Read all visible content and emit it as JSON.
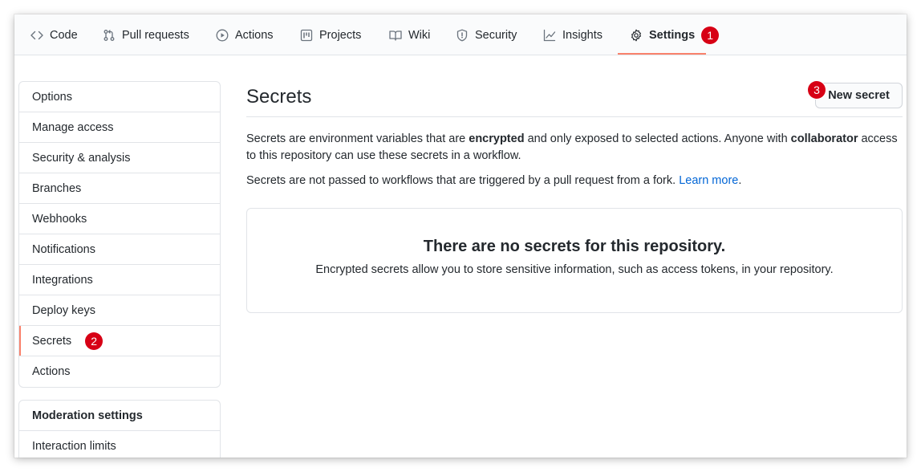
{
  "nav": {
    "tabs": [
      {
        "label": "Code",
        "icon": "code-icon"
      },
      {
        "label": "Pull requests",
        "icon": "pull-request-icon"
      },
      {
        "label": "Actions",
        "icon": "play-icon"
      },
      {
        "label": "Projects",
        "icon": "project-icon"
      },
      {
        "label": "Wiki",
        "icon": "book-icon"
      },
      {
        "label": "Security",
        "icon": "shield-icon"
      },
      {
        "label": "Insights",
        "icon": "graph-icon"
      },
      {
        "label": "Settings",
        "icon": "gear-icon",
        "active": true
      }
    ],
    "settings_badge": "1"
  },
  "sidebar": {
    "items": [
      {
        "label": "Options"
      },
      {
        "label": "Manage access"
      },
      {
        "label": "Security & analysis"
      },
      {
        "label": "Branches"
      },
      {
        "label": "Webhooks"
      },
      {
        "label": "Notifications"
      },
      {
        "label": "Integrations"
      },
      {
        "label": "Deploy keys"
      },
      {
        "label": "Secrets",
        "selected": true
      },
      {
        "label": "Actions"
      }
    ],
    "secrets_badge": "2",
    "moderation": {
      "heading": "Moderation settings",
      "items": [
        {
          "label": "Interaction limits"
        }
      ]
    }
  },
  "main": {
    "title": "Secrets",
    "new_secret_label": "New secret",
    "new_secret_badge": "3",
    "description": {
      "p1_part1": "Secrets are environment variables that are ",
      "p1_bold1": "encrypted",
      "p1_part2": " and only exposed to selected actions. Anyone with ",
      "p1_bold2": "collaborator",
      "p1_part3": " access to this repository can use these secrets in a workflow.",
      "p2_text": "Secrets are not passed to workflows that are triggered by a pull request from a fork. ",
      "p2_link": "Learn more",
      "p2_end": "."
    },
    "empty_state": {
      "title": "There are no secrets for this repository.",
      "description": "Encrypted secrets allow you to store sensitive information, such as access tokens, in your repository."
    }
  },
  "colors": {
    "accent_underline": "#f9826c",
    "badge": "#d70015",
    "link": "#0366d6",
    "border": "#e1e4e8"
  }
}
